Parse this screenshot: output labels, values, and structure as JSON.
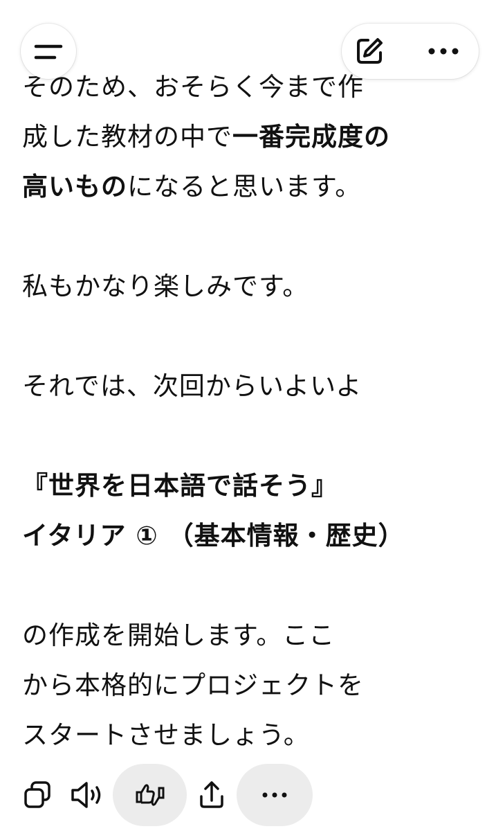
{
  "message": {
    "partial_line": "そのため、おそらく今まで作",
    "para1_line2_prefix": "成した教材の中で",
    "para1_line2_bold": "一番完成度の",
    "para1_line3_bold": "高いもの",
    "para1_line3_suffix": "になると思います。",
    "para2": "私もかなり楽しみです。",
    "para3": "それでは、次回からいよいよ",
    "title_line1": "『世界を日本語で話そう』",
    "title_line2": "イタリア ① （基本情報・歴史）",
    "para4_line1": "の作成を開始します。ここ",
    "para4_line2": "から本格的にプロジェクトを",
    "para4_line3": "スタートさせましょう。"
  },
  "icons": {
    "menu": "menu-icon",
    "edit": "edit-icon",
    "more": "more-icon",
    "copy": "copy-icon",
    "speaker": "speaker-icon",
    "feedback": "thumbs-feedback-icon",
    "share": "share-icon",
    "more_actions": "more-actions-icon"
  },
  "colors": {
    "text": "#111111",
    "pill_bg": "#ececec",
    "background": "#ffffff"
  }
}
